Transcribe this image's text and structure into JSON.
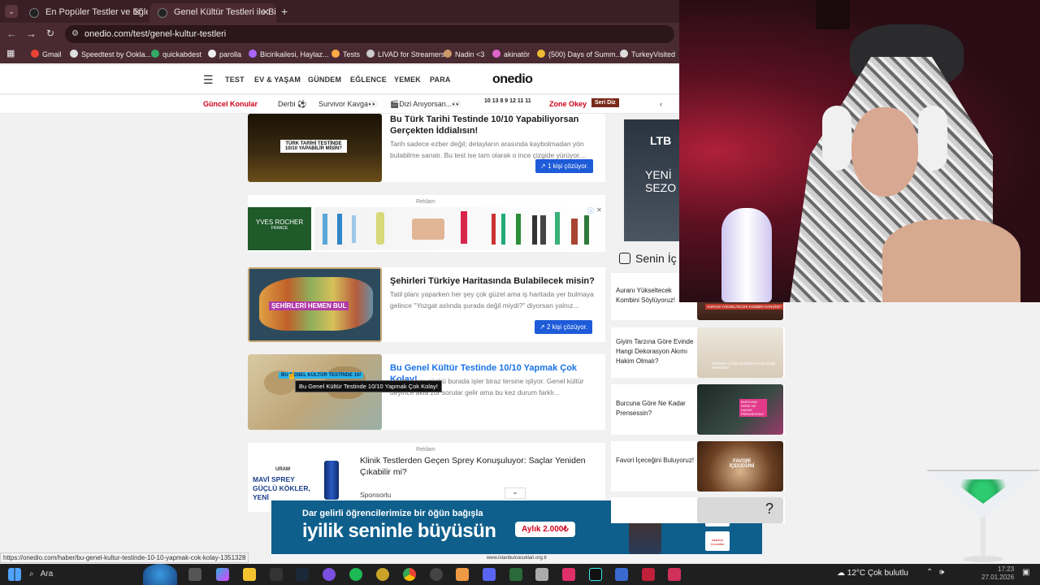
{
  "browser": {
    "tabs": [
      {
        "title": "En Popüler Testler ve Eğlenceli"
      },
      {
        "title": "Genel Kültür Testleri ile Bilgini T"
      }
    ],
    "new_tab": "+",
    "url": "onedio.com/test/genel-kultur-testleri",
    "bookmarks": [
      "Gmail",
      "Speedtest by Ookla...",
      "quickabdest",
      "parolla",
      "Bicirikailesi, Haylaz...",
      "Tests",
      "LIVAD for Streamers",
      "Nadin <3",
      "akinatör",
      "(500) Days of Summ...",
      "TurkeyVisited"
    ]
  },
  "site": {
    "logo": "onedio",
    "nav": [
      "TEST",
      "EV & YAŞAM",
      "GÜNDEM",
      "EĞLENCE",
      "YEMEK",
      "PARA"
    ],
    "trends_label": "Güncel Konular",
    "trends": [
      "Derbi ⚽",
      "Survivor Kavga👀",
      "🎬Dizi Anıyorsan...👀",
      "Zone Okey",
      "Seri Diz"
    ],
    "trend_digits": "10 13 8 9 12 11 11"
  },
  "cards": [
    {
      "title": "Bu Türk Tarihi Testinde 10/10 Yapabiliyorsan Gerçekten İddialısın!",
      "desc": "Tarih sadece ezber değil; detayların arasında kaybolmadan yön bulabilme sanatı. Bu test ise tam olarak o ince çizgide yürüyor....",
      "solve": "1 kişi çözüyor.",
      "thumb_text": "TÜRK TARİHİ TESTİNDE 10/10 YAPABİLİR MİSİN?"
    },
    {
      "title": "Şehirleri Türkiye Haritasında Bulabilecek misin?",
      "desc": "Tatil planı yaparken her şey çok güzel ama iş haritada yer bulmaya gelince \"Yozgat aslında şurada değil miydi?\" diyorsan yalnız...",
      "solve": "2 kişi çözüyor.",
      "thumb_text": "ŞEHİRLERİ HEMEN BUL"
    },
    {
      "title": "Bu Genel Kültür Testinde 10/10 Yapmak Çok Kolay!",
      "desc": "...kutmasın, çünkü burada işler biraz tersine işliyor. Genel kültür deyince akla zor sorular gelir ama bu kez durum farklı...",
      "tooltip": "Bu Genel Kültür Testinde 10/10 Yapmak Çok Kolay!",
      "thumb_text": "BU GENEL KÜLTÜR TESTİNDE 10/"
    }
  ],
  "ads": {
    "label": "Reklam",
    "brand": "YVES ROCHER",
    "brand_sub": "FRANCE",
    "sponsored_title": "Klinik Testlerden Geçen Sprey Konuşuluyor: Saçlar Yeniden Çıkabilir mi?",
    "sponsored_label": "Sponsorlu",
    "spray_brand": "URAW",
    "spray_text": "MAVİ SPREY GÜÇLÜ KÖKLER, YENİ",
    "banner_line1": "Dar gelirli öğrencilerimize bir öğün bağışla",
    "banner_line2": "iyilik seninle büyüsün",
    "banner_amount": "Aylık 2.000₺",
    "banner_url": "www.istanbulcocuklari.org.tr",
    "banner_partner": "istanbul Çocukları"
  },
  "sidebar": {
    "ad_text1": "LTB",
    "ad_text2": "YENİ SEZO",
    "section_title": "Senin İç",
    "items": [
      {
        "title": "Auranı Yükseltecek Kombini Söylüyoruz!",
        "img_text": "AURANI YÜKSELTECEK KOMBİN HANGİSİ?"
      },
      {
        "title": "Giyim Tarzına Göre Evinde Hangi Dekorasyon Akımı Hakim Olmalı?",
        "img_text": "TARZINA UYAN DEKORASYON AKIMI HANGİSİ?"
      },
      {
        "title": "Burcuna Göre Ne Kadar Prensessin?",
        "img_text": "BURCUNA GÖRE NE KADAR PRENSESSİN?"
      },
      {
        "title": "Favori İçeceğini Buluyoruz!",
        "img_text": "FAVORİ İÇECEĞİNİ"
      }
    ]
  },
  "status_url": "https://onedio.com/haber/bu-genel-kultur-testinde-10-10-yapmak-cok-kolay-1351328",
  "taskbar": {
    "search": "Ara",
    "weather": "12°C Çok bulutlu",
    "time": "17:23",
    "date": "27.01.2026"
  }
}
